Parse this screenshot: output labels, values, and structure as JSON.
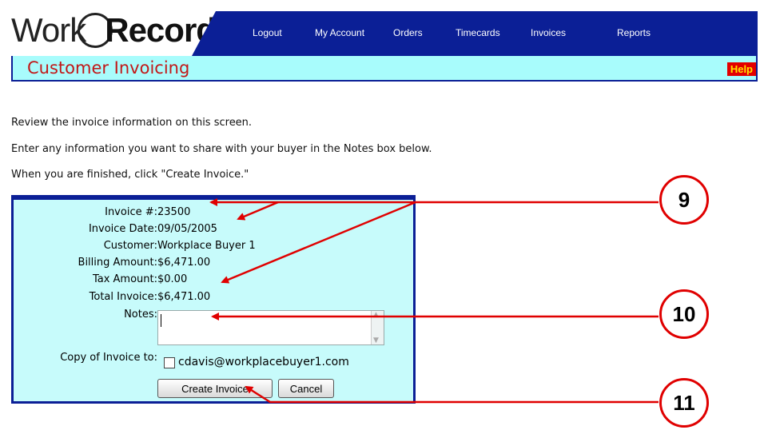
{
  "logo": {
    "work": "Work",
    "records": "Records"
  },
  "nav": [
    "Logout",
    "My Account",
    "Orders",
    "Timecards",
    "Invoices",
    "Reports"
  ],
  "page_title": "Customer Invoicing",
  "help_label": "Help",
  "instructions": [
    "Review the invoice information on this screen.",
    "Enter any information you want to share with your buyer in the Notes box below.",
    "When you are finished, click \"Create Invoice.\""
  ],
  "invoice": {
    "fields": [
      {
        "label": "Invoice #:",
        "value": "23500"
      },
      {
        "label": "Invoice Date:",
        "value": "09/05/2005"
      },
      {
        "label": "Customer:",
        "value": "Workplace Buyer 1"
      },
      {
        "label": "Billing Amount:",
        "value": "$6,471.00"
      },
      {
        "label": "Tax Amount:",
        "value": "$0.00"
      },
      {
        "label": "Total Invoice:",
        "value": "$6,471.00"
      }
    ],
    "notes_label": "Notes:",
    "notes_value": "",
    "copy_label": "Copy of Invoice to:",
    "copy_email": "cdavis@workplacebuyer1.com",
    "create_button": "Create Invoice",
    "cancel_button": "Cancel"
  },
  "callouts": [
    "9",
    "10",
    "11"
  ],
  "colors": {
    "nav_bg": "#0b1f96",
    "title_bg": "#a8fcfc",
    "title_text": "#c21818",
    "panel_bg": "#c7fbfb",
    "callout": "#e00000"
  }
}
